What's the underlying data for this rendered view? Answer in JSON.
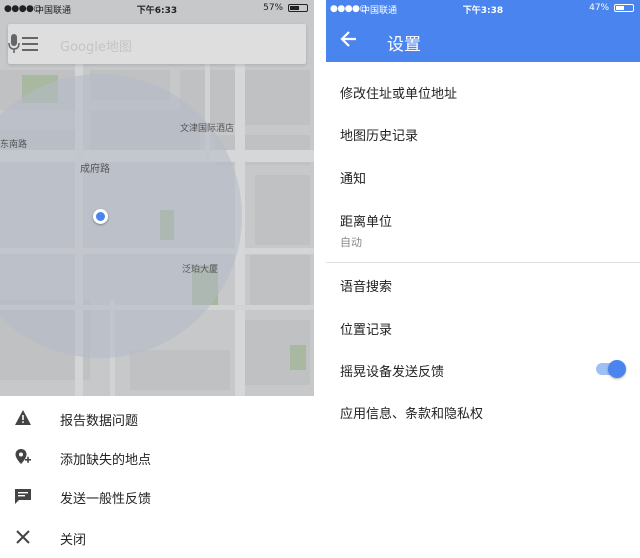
{
  "left": {
    "status_bar": {
      "signal": "●●●●○",
      "carrier": "中国联通",
      "time": "下午6:33",
      "battery": "57%",
      "battery_level": 0.57
    },
    "search": {
      "placeholder": "Google地图"
    },
    "map_labels": {
      "hotel": "文津国际酒店",
      "road_main": "成府路",
      "road_left": "东南路",
      "building": "泛珀大厦"
    },
    "menu": [
      {
        "label": "报告数据问题",
        "icon": "warning-icon"
      },
      {
        "label": "添加缺失的地点",
        "icon": "add-place-icon"
      },
      {
        "label": "发送一般性反馈",
        "icon": "feedback-icon"
      },
      {
        "label": "关闭",
        "icon": "close-icon"
      }
    ]
  },
  "right": {
    "status_bar": {
      "signal": "●●●●○",
      "carrier": "中国联通",
      "time": "下午3:38",
      "battery": "47%",
      "battery_level": 0.47
    },
    "title": "设置",
    "settings": [
      {
        "label": "修改住址或单位地址"
      },
      {
        "label": "地图历史记录"
      },
      {
        "label": "通知"
      },
      {
        "label": "距离单位",
        "sublabel": "自动"
      },
      {
        "label": "语音搜索"
      },
      {
        "label": "位置记录"
      },
      {
        "label": "摇晃设备发送反馈",
        "toggle": true
      },
      {
        "label": "应用信息、条款和隐私权"
      }
    ]
  },
  "colors": {
    "accent": "#4a84ee",
    "map_overlay": "#c9cbcd",
    "location_dot": "#4a84ee"
  }
}
